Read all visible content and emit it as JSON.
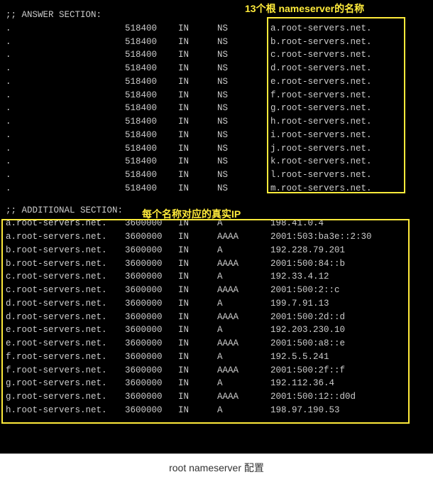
{
  "annotations": {
    "top": "13个根 nameserver的名称",
    "mid": "每个名称对应的真实IP"
  },
  "sections": {
    "answer": ";; ANSWER SECTION:",
    "additional": ";; ADDITIONAL SECTION:"
  },
  "answer_records": [
    {
      "name": ".",
      "ttl": "518400",
      "class": "IN",
      "type": "NS",
      "value": "a.root-servers.net."
    },
    {
      "name": ".",
      "ttl": "518400",
      "class": "IN",
      "type": "NS",
      "value": "b.root-servers.net."
    },
    {
      "name": ".",
      "ttl": "518400",
      "class": "IN",
      "type": "NS",
      "value": "c.root-servers.net."
    },
    {
      "name": ".",
      "ttl": "518400",
      "class": "IN",
      "type": "NS",
      "value": "d.root-servers.net."
    },
    {
      "name": ".",
      "ttl": "518400",
      "class": "IN",
      "type": "NS",
      "value": "e.root-servers.net."
    },
    {
      "name": ".",
      "ttl": "518400",
      "class": "IN",
      "type": "NS",
      "value": "f.root-servers.net."
    },
    {
      "name": ".",
      "ttl": "518400",
      "class": "IN",
      "type": "NS",
      "value": "g.root-servers.net."
    },
    {
      "name": ".",
      "ttl": "518400",
      "class": "IN",
      "type": "NS",
      "value": "h.root-servers.net."
    },
    {
      "name": ".",
      "ttl": "518400",
      "class": "IN",
      "type": "NS",
      "value": "i.root-servers.net."
    },
    {
      "name": ".",
      "ttl": "518400",
      "class": "IN",
      "type": "NS",
      "value": "j.root-servers.net."
    },
    {
      "name": ".",
      "ttl": "518400",
      "class": "IN",
      "type": "NS",
      "value": "k.root-servers.net."
    },
    {
      "name": ".",
      "ttl": "518400",
      "class": "IN",
      "type": "NS",
      "value": "l.root-servers.net."
    },
    {
      "name": ".",
      "ttl": "518400",
      "class": "IN",
      "type": "NS",
      "value": "m.root-servers.net."
    }
  ],
  "additional_records": [
    {
      "name": "a.root-servers.net.",
      "ttl": "3600000",
      "class": "IN",
      "type": "A",
      "value": "198.41.0.4"
    },
    {
      "name": "a.root-servers.net.",
      "ttl": "3600000",
      "class": "IN",
      "type": "AAAA",
      "value": "2001:503:ba3e::2:30"
    },
    {
      "name": "b.root-servers.net.",
      "ttl": "3600000",
      "class": "IN",
      "type": "A",
      "value": "192.228.79.201"
    },
    {
      "name": "b.root-servers.net.",
      "ttl": "3600000",
      "class": "IN",
      "type": "AAAA",
      "value": "2001:500:84::b"
    },
    {
      "name": "c.root-servers.net.",
      "ttl": "3600000",
      "class": "IN",
      "type": "A",
      "value": "192.33.4.12"
    },
    {
      "name": "c.root-servers.net.",
      "ttl": "3600000",
      "class": "IN",
      "type": "AAAA",
      "value": "2001:500:2::c"
    },
    {
      "name": "d.root-servers.net.",
      "ttl": "3600000",
      "class": "IN",
      "type": "A",
      "value": "199.7.91.13"
    },
    {
      "name": "d.root-servers.net.",
      "ttl": "3600000",
      "class": "IN",
      "type": "AAAA",
      "value": "2001:500:2d::d"
    },
    {
      "name": "e.root-servers.net.",
      "ttl": "3600000",
      "class": "IN",
      "type": "A",
      "value": "192.203.230.10"
    },
    {
      "name": "e.root-servers.net.",
      "ttl": "3600000",
      "class": "IN",
      "type": "AAAA",
      "value": "2001:500:a8::e"
    },
    {
      "name": "f.root-servers.net.",
      "ttl": "3600000",
      "class": "IN",
      "type": "A",
      "value": "192.5.5.241"
    },
    {
      "name": "f.root-servers.net.",
      "ttl": "3600000",
      "class": "IN",
      "type": "AAAA",
      "value": "2001:500:2f::f"
    },
    {
      "name": "g.root-servers.net.",
      "ttl": "3600000",
      "class": "IN",
      "type": "A",
      "value": "192.112.36.4"
    },
    {
      "name": "g.root-servers.net.",
      "ttl": "3600000",
      "class": "IN",
      "type": "AAAA",
      "value": "2001:500:12::d0d"
    },
    {
      "name": "h.root-servers.net.",
      "ttl": "3600000",
      "class": "IN",
      "type": "A",
      "value": "198.97.190.53"
    }
  ],
  "caption": "root nameserver 配置"
}
